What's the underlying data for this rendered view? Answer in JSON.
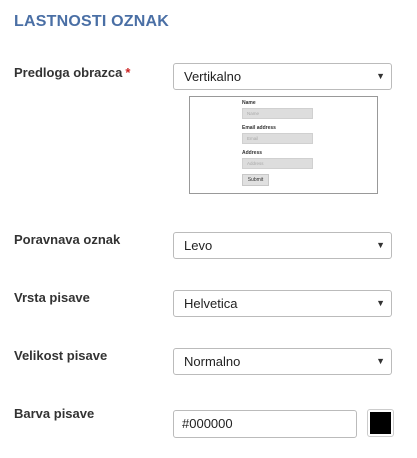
{
  "section_title": "LASTNOSTI OZNAK",
  "fields": {
    "template": {
      "label": "Predloga obrazca",
      "required_mark": "*",
      "value": "Vertikalno"
    },
    "alignment": {
      "label": "Poravnava oznak",
      "value": "Levo"
    },
    "font_family": {
      "label": "Vrsta pisave",
      "value": "Helvetica"
    },
    "font_size": {
      "label": "Velikost pisave",
      "value": "Normalno"
    },
    "font_color": {
      "label": "Barva pisave",
      "value": "#000000",
      "swatch_color": "#000000"
    }
  },
  "preview": {
    "name_label": "Name",
    "name_placeholder": "Name",
    "email_label": "Email address",
    "email_placeholder": "Email",
    "address_label": "Address",
    "address_placeholder": "Address",
    "submit_label": "Submit"
  },
  "icons": {
    "dropdown": "chevron-down-icon"
  },
  "colors": {
    "title": "#4a6fa5",
    "required": "#cc2222"
  }
}
